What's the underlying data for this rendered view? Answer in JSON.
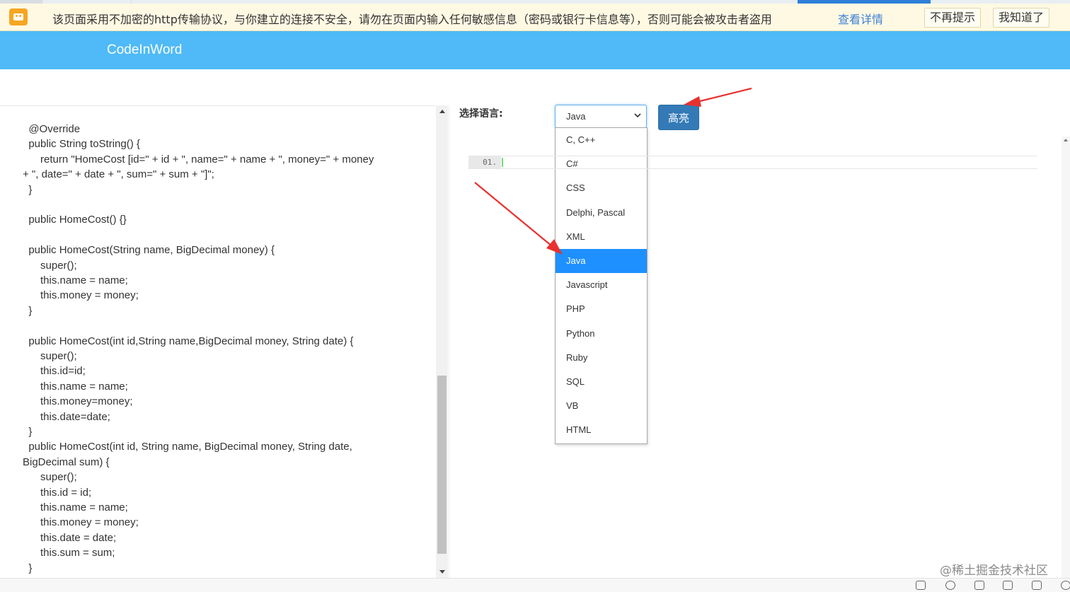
{
  "security_bar": {
    "message": "该页面采用不加密的http传输协议，与你建立的连接不安全，请勿在页面内输入任何敏感信息（密码或银行卡信息等），否则可能会被攻击者盗用",
    "details_link": "查看详情",
    "dont_remind": "不再提示",
    "got_it": "我知道了"
  },
  "header": {
    "brand": "CodeInWord"
  },
  "code_lines": [
    "    @Override",
    "    public String toString() {",
    "        return \"HomeCost [id=\" + id + \", name=\" + name + \", money=\" + money",
    "+ \", date=\" + date + \", sum=\" + sum + \"]\";",
    "    }",
    "",
    "    public HomeCost() {}",
    "",
    "    public HomeCost(String name, BigDecimal money) {",
    "        super();",
    "        this.name = name;",
    "        this.money = money;",
    "    }",
    "",
    "    public HomeCost(int id,String name,BigDecimal money, String date) {",
    "        super();",
    "        this.id=id;",
    "        this.name = name;",
    "        this.money=money;",
    "        this.date=date;",
    "    }",
    "    public HomeCost(int id, String name, BigDecimal money, String date,",
    "BigDecimal sum) {",
    "        super();",
    "        this.id = id;",
    "        this.name = name;",
    "        this.money = money;",
    "        this.date = date;",
    "        this.sum = sum;",
    "    }"
  ],
  "controls": {
    "language_label": "选择语言:",
    "selected_language": "Java",
    "highlight_button": "高亮"
  },
  "language_options": [
    "C, C++",
    "C#",
    "CSS",
    "Delphi, Pascal",
    "XML",
    "Java",
    "Javascript",
    "PHP",
    "Python",
    "Ruby",
    "SQL",
    "VB",
    "HTML"
  ],
  "selected_index": 5,
  "editor": {
    "line_number": "01."
  },
  "watermark": "@稀土掘金技术社区",
  "colors": {
    "header": "#4fbaf7",
    "selected_option": "#1e90ff",
    "button": "#337ab7",
    "annotation_arrow": "#e8312f"
  }
}
